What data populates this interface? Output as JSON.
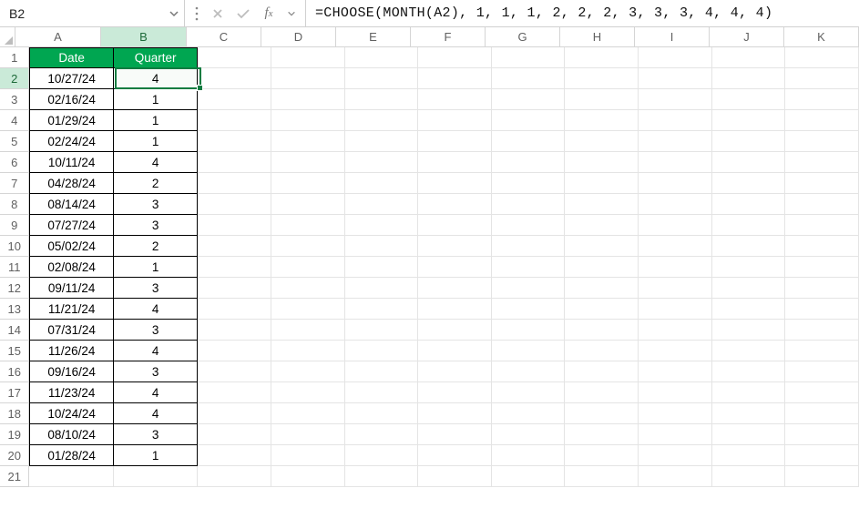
{
  "nameBox": "B2",
  "formula": "=CHOOSE(MONTH(A2), 1, 1, 1, 2, 2, 2, 3, 3, 3, 4, 4, 4)",
  "columns": [
    "A",
    "B",
    "C",
    "D",
    "E",
    "F",
    "G",
    "H",
    "I",
    "J",
    "K"
  ],
  "rowCount": 21,
  "activeCell": {
    "col": "B",
    "row": 2
  },
  "table": {
    "headers": {
      "A": "Date",
      "B": "Quarter"
    },
    "rows": [
      {
        "A": "10/27/24",
        "B": "4"
      },
      {
        "A": "02/16/24",
        "B": "1"
      },
      {
        "A": "01/29/24",
        "B": "1"
      },
      {
        "A": "02/24/24",
        "B": "1"
      },
      {
        "A": "10/11/24",
        "B": "4"
      },
      {
        "A": "04/28/24",
        "B": "2"
      },
      {
        "A": "08/14/24",
        "B": "3"
      },
      {
        "A": "07/27/24",
        "B": "3"
      },
      {
        "A": "05/02/24",
        "B": "2"
      },
      {
        "A": "02/08/24",
        "B": "1"
      },
      {
        "A": "09/11/24",
        "B": "3"
      },
      {
        "A": "11/21/24",
        "B": "4"
      },
      {
        "A": "07/31/24",
        "B": "3"
      },
      {
        "A": "11/26/24",
        "B": "4"
      },
      {
        "A": "09/16/24",
        "B": "3"
      },
      {
        "A": "11/23/24",
        "B": "4"
      },
      {
        "A": "10/24/24",
        "B": "4"
      },
      {
        "A": "08/10/24",
        "B": "3"
      },
      {
        "A": "01/28/24",
        "B": "1"
      }
    ]
  },
  "chart_data": {
    "type": "table",
    "title": "",
    "columns": [
      "Date",
      "Quarter"
    ],
    "rows": [
      [
        "10/27/24",
        4
      ],
      [
        "02/16/24",
        1
      ],
      [
        "01/29/24",
        1
      ],
      [
        "02/24/24",
        1
      ],
      [
        "10/11/24",
        4
      ],
      [
        "04/28/24",
        2
      ],
      [
        "08/14/24",
        3
      ],
      [
        "07/27/24",
        3
      ],
      [
        "05/02/24",
        2
      ],
      [
        "02/08/24",
        1
      ],
      [
        "09/11/24",
        3
      ],
      [
        "11/21/24",
        4
      ],
      [
        "07/31/24",
        3
      ],
      [
        "11/26/24",
        4
      ],
      [
        "09/16/24",
        3
      ],
      [
        "11/23/24",
        4
      ],
      [
        "10/24/24",
        4
      ],
      [
        "08/10/24",
        3
      ],
      [
        "01/28/24",
        1
      ]
    ]
  }
}
